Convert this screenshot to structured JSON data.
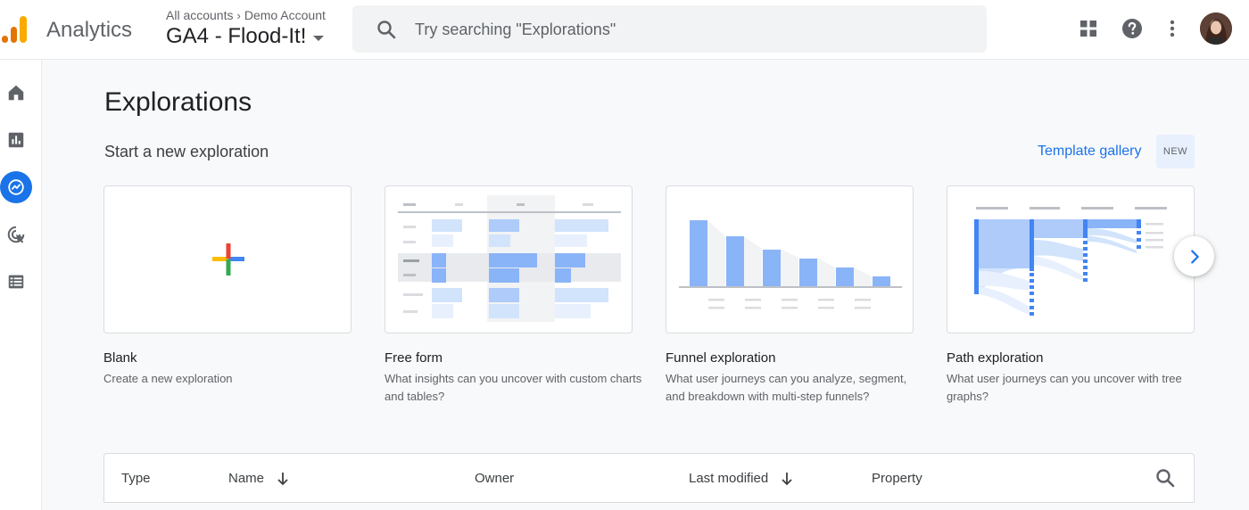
{
  "header": {
    "app_name": "Analytics",
    "breadcrumb": {
      "accounts": "All accounts",
      "account": "Demo Account"
    },
    "property": "GA4 - Flood-It!",
    "search_placeholder": "Try searching \"Explorations\"",
    "icons": [
      "apps-grid-icon",
      "help-icon",
      "more-vert-icon"
    ]
  },
  "leftnav": {
    "items": [
      {
        "name": "home",
        "icon": "home-icon",
        "active": false
      },
      {
        "name": "reports",
        "icon": "bar-chart-icon",
        "active": false
      },
      {
        "name": "explore",
        "icon": "explore-icon",
        "active": true
      },
      {
        "name": "advertising",
        "icon": "target-cursor-icon",
        "active": false
      },
      {
        "name": "configure",
        "icon": "list-icon",
        "active": false
      }
    ]
  },
  "main": {
    "title": "Explorations",
    "section_title": "Start a new exploration",
    "template_gallery": "Template gallery",
    "new_badge": "NEW",
    "cards": [
      {
        "title": "Blank",
        "description": "Create a new exploration"
      },
      {
        "title": "Free form",
        "description": "What insights can you uncover with custom charts and tables?"
      },
      {
        "title": "Funnel exploration",
        "description": "What user journeys can you analyze, segment, and breakdown with multi-step funnels?"
      },
      {
        "title": "Path exploration",
        "description": "What user journeys can you uncover with tree graphs?"
      }
    ]
  },
  "table": {
    "columns": {
      "type": "Type",
      "name": "Name",
      "owner": "Owner",
      "last_modified": "Last modified",
      "property": "Property"
    }
  },
  "colors": {
    "accent": "#1a73e8",
    "logo_orange": "#f9ab00",
    "logo_dark_orange": "#e37400",
    "chart_blue": "#8ab4f8",
    "chart_light_blue": "#d2e3fc"
  }
}
